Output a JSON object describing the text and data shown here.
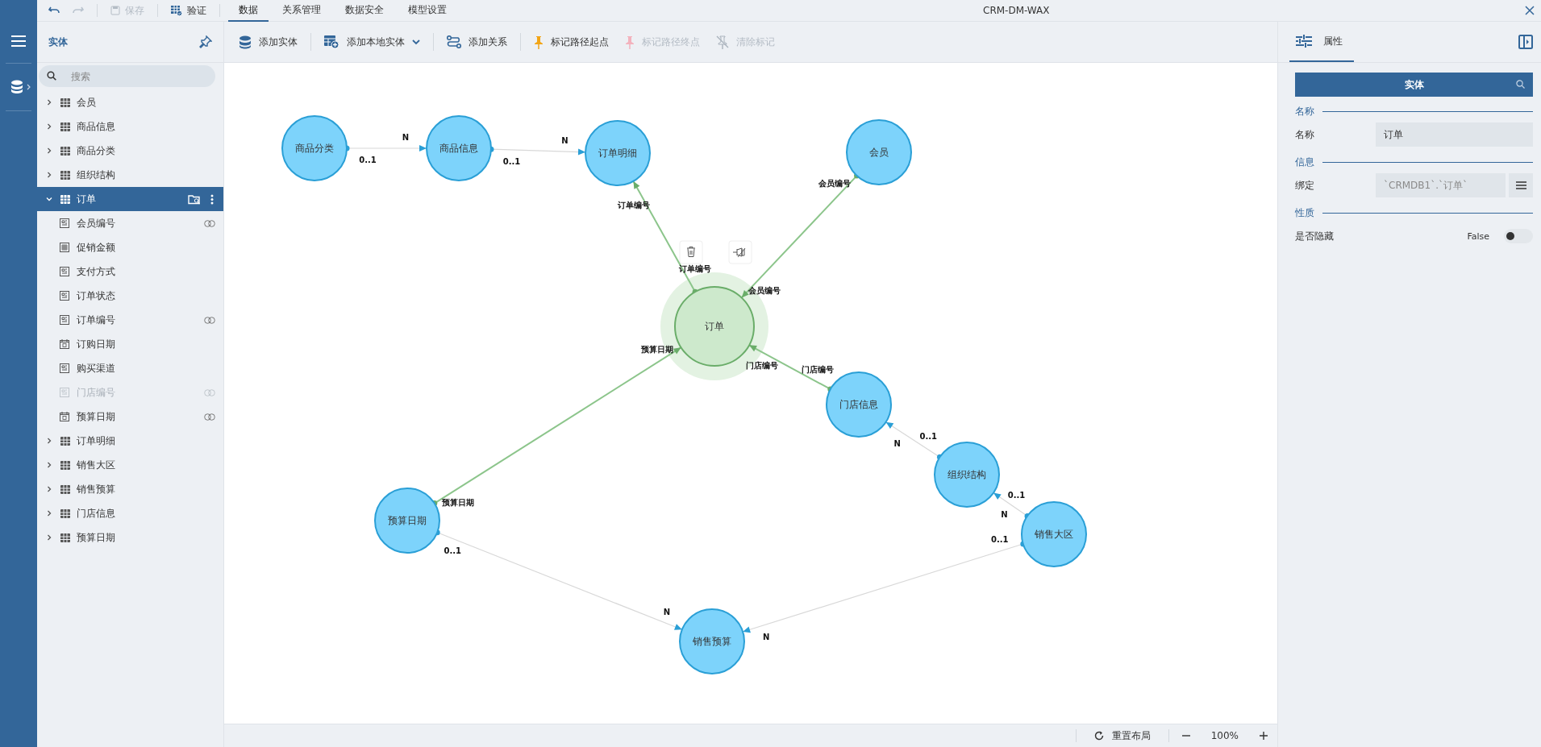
{
  "window": {
    "title": "CRM-DM-WAX"
  },
  "quick_actions": [
    {
      "kind": "undo",
      "disabled": false
    },
    {
      "kind": "redo",
      "disabled": true
    },
    {
      "kind": "save",
      "label": "保存",
      "disabled": true
    },
    {
      "kind": "validate",
      "label": "验证",
      "disabled": false
    }
  ],
  "menu_tabs": [
    {
      "label": "数据",
      "selected": true
    },
    {
      "label": "关系管理",
      "selected": false
    },
    {
      "label": "数据安全",
      "selected": false
    },
    {
      "label": "模型设置",
      "selected": false
    }
  ],
  "entity_panel": {
    "title": "实体",
    "search": {
      "placeholder": "搜索"
    },
    "tree": [
      {
        "label": "会员",
        "expanded": false,
        "selected": false
      },
      {
        "label": "商品信息",
        "expanded": false,
        "selected": false
      },
      {
        "label": "商品分类",
        "expanded": false,
        "selected": false
      },
      {
        "label": "组织结构",
        "expanded": false,
        "selected": false
      },
      {
        "label": "订单",
        "expanded": true,
        "selected": true,
        "children": [
          {
            "label": "会员编号",
            "kind": "text",
            "linked": true,
            "disabled": false
          },
          {
            "label": "促销金额",
            "kind": "number",
            "linked": false,
            "disabled": false
          },
          {
            "label": "支付方式",
            "kind": "text",
            "linked": false,
            "disabled": false
          },
          {
            "label": "订单状态",
            "kind": "text",
            "linked": false,
            "disabled": false
          },
          {
            "label": "订单编号",
            "kind": "text",
            "linked": true,
            "disabled": false
          },
          {
            "label": "订购日期",
            "kind": "date",
            "linked": false,
            "disabled": false
          },
          {
            "label": "购买渠道",
            "kind": "text",
            "linked": false,
            "disabled": false
          },
          {
            "label": "门店编号",
            "kind": "text",
            "linked": true,
            "disabled": true
          },
          {
            "label": "预算日期",
            "kind": "date",
            "linked": true,
            "disabled": false
          }
        ]
      },
      {
        "label": "订单明细",
        "expanded": false,
        "selected": false
      },
      {
        "label": "销售大区",
        "expanded": false,
        "selected": false
      },
      {
        "label": "销售预算",
        "expanded": false,
        "selected": false
      },
      {
        "label": "门店信息",
        "expanded": false,
        "selected": false
      },
      {
        "label": "预算日期",
        "expanded": false,
        "selected": false
      }
    ]
  },
  "toolbar": [
    {
      "kind": "add-entity",
      "label": "添加实体",
      "disabled": false
    },
    {
      "kind": "add-local",
      "label": "添加本地实体",
      "disabled": false
    },
    {
      "kind": "add-relation",
      "label": "添加关系",
      "disabled": false
    },
    {
      "kind": "mark-start",
      "label": "标记路径起点",
      "disabled": false
    },
    {
      "kind": "mark-end",
      "label": "标记路径终点",
      "disabled": true
    },
    {
      "kind": "clear-marks",
      "label": "清除标记",
      "disabled": true
    }
  ],
  "diagram": {
    "nodes": [
      {
        "label": "商品分类",
        "selected": false
      },
      {
        "label": "商品信息",
        "selected": false
      },
      {
        "label": "订单明细",
        "selected": false
      },
      {
        "label": "会员",
        "selected": false
      },
      {
        "label": "订单",
        "selected": true
      },
      {
        "label": "门店信息",
        "selected": false
      },
      {
        "label": "组织结构",
        "selected": false
      },
      {
        "label": "销售大区",
        "selected": false
      },
      {
        "label": "预算日期",
        "selected": false
      },
      {
        "label": "销售预算",
        "selected": false
      }
    ],
    "edges": [
      {
        "kind": "plain",
        "from_label": "0..1",
        "to_label": "N"
      },
      {
        "kind": "plain",
        "from_label": "0..1",
        "to_label": "N"
      },
      {
        "kind": "focus",
        "from_label": "订单编号",
        "to_label": "订单编号"
      },
      {
        "kind": "focus",
        "from_label": "会员编号",
        "to_label": "会员编号"
      },
      {
        "kind": "focus",
        "from_label": "门店编号",
        "to_label": "门店编号"
      },
      {
        "kind": "focus",
        "from_label": "预算日期",
        "to_label": "预算日期"
      },
      {
        "kind": "plain",
        "from_label": "0..1",
        "to_label": "N"
      },
      {
        "kind": "plain",
        "from_label": "0..1",
        "to_label": "N"
      },
      {
        "kind": "plain",
        "from_label": "0..1",
        "to_label": "N"
      },
      {
        "kind": "plain",
        "from_label": "0..1",
        "to_label": "N"
      }
    ],
    "node_actions": [
      {
        "kind": "delete"
      },
      {
        "kind": "unpin"
      }
    ]
  },
  "zoom_bar": {
    "reset": "重置布局",
    "zoom": "100%"
  },
  "properties": {
    "tab": {
      "label": "属性",
      "selected": true
    },
    "header": "实体",
    "sections": [
      {
        "title": "名称",
        "rows": [
          {
            "kind": "text",
            "label": "名称",
            "value": "订单"
          }
        ]
      },
      {
        "title": "信息",
        "rows": [
          {
            "kind": "binding",
            "label": "绑定",
            "value": "`CRMDB1`.`订单`"
          }
        ]
      },
      {
        "title": "性质",
        "rows": [
          {
            "kind": "toggle",
            "label": "是否隐藏",
            "value": "False",
            "on": false
          }
        ]
      }
    ]
  }
}
